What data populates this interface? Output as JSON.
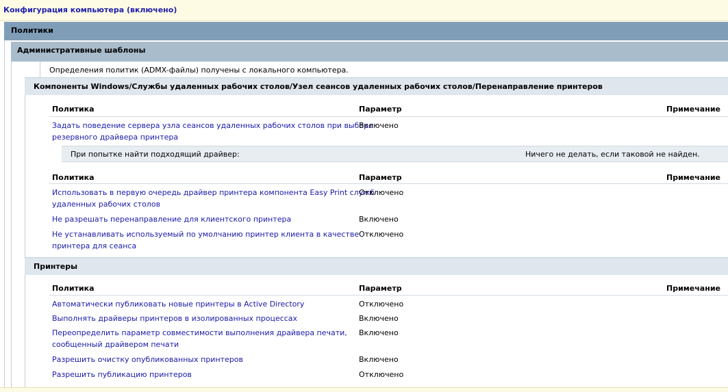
{
  "header": {
    "title": "Конфигурация компьютера (включено)"
  },
  "sections": {
    "policies": "Политики",
    "admin_templates": "Административные шаблоны",
    "admx_note": "Определения политик (ADMX-файлы) получены с локального компьютера.",
    "rds_printer_redirection": "Компоненты Windows/Службы удаленных рабочих столов/Узел сеансов удаленных рабочих столов/Перенаправление принтеров",
    "printers": "Принтеры"
  },
  "columns": {
    "policy": "Политика",
    "setting": "Параметр",
    "comment": "Примечание"
  },
  "table1": {
    "rows": [
      {
        "line1": "Задать поведение сервера узла сеансов удаленных рабочих столов при выборе",
        "line2": "резервного драйвера принтера",
        "value": "Включено"
      }
    ],
    "sub": {
      "label": "При попытке найти подходящий драйвер:",
      "value": "Ничего не делать, если таковой не найден."
    }
  },
  "table2": {
    "rows": [
      {
        "line1": "Использовать в первую очередь драйвер принтера компонента Easy Print служб",
        "line2": "удаленных рабочих столов",
        "value": "Отключено"
      },
      {
        "line1": "Не разрешать перенаправление для клиентского принтера",
        "line2": "",
        "value": "Включено"
      },
      {
        "line1": "Не устанавливать используемый по умолчанию принтер клиента в качестве",
        "line2": "принтера для сеанса",
        "value": "Отключено"
      }
    ]
  },
  "table3": {
    "rows": [
      {
        "line1": "Автоматически публиковать новые принтеры в Active Directory",
        "line2": "",
        "value": "Отключено"
      },
      {
        "line1": "Выполнять драйверы принтеров в изолированных процессах",
        "line2": "",
        "value": "Включено"
      },
      {
        "line1": "Переопределить параметр совместимости выполнения драйвера печати,",
        "line2": "сообщенный драйвером печати",
        "value": "Включено"
      },
      {
        "line1": "Разрешить очистку опубликованных принтеров",
        "line2": "",
        "value": "Включено"
      },
      {
        "line1": "Разрешить публикацию принтеров",
        "line2": "",
        "value": "Отключено"
      }
    ]
  }
}
